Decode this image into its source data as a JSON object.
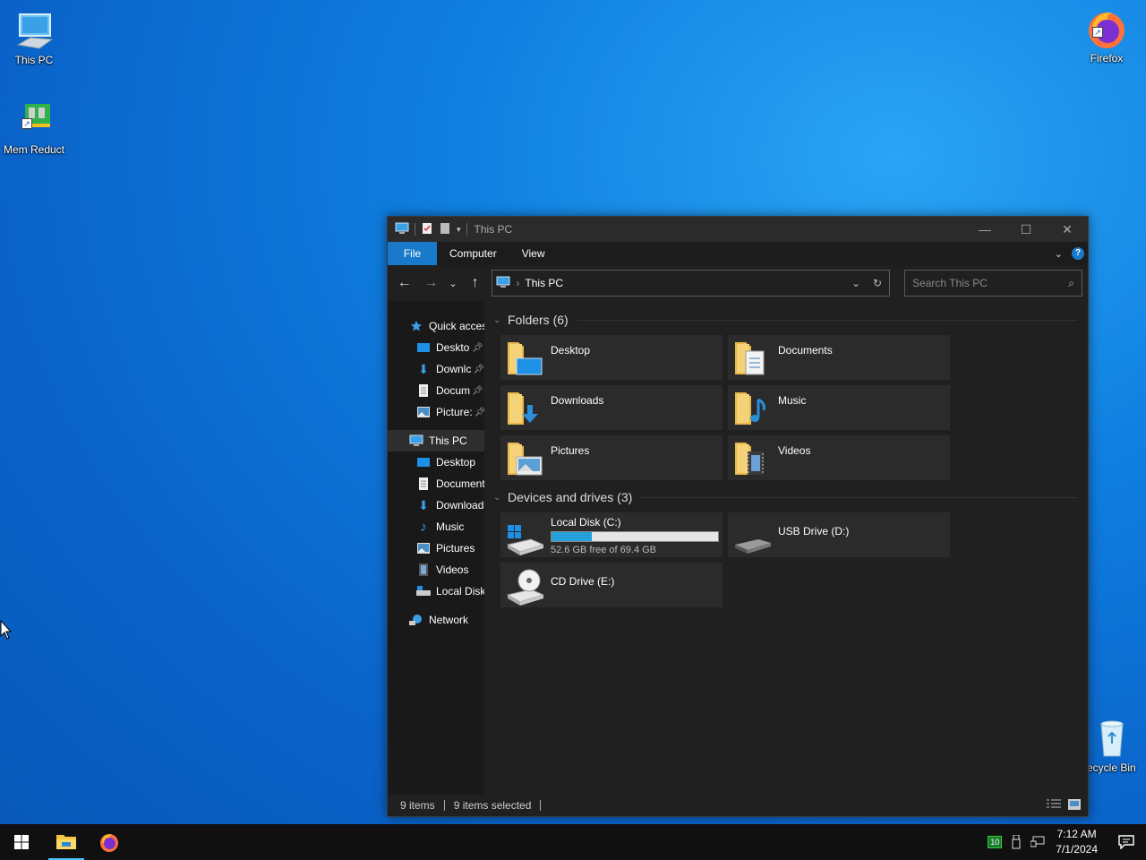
{
  "desktop": {
    "icons": [
      {
        "label": "This PC"
      },
      {
        "label": "Mem Reduct"
      },
      {
        "label": "Firefox"
      },
      {
        "label": "ecycle Bin"
      }
    ]
  },
  "window": {
    "title": "This PC",
    "controls": {
      "minimize": "—",
      "maximize": "☐",
      "close": "✕"
    },
    "ribbon": {
      "tabs": [
        "File",
        "Computer",
        "View"
      ],
      "help": "?"
    },
    "address": {
      "crumb": "This PC"
    },
    "search": {
      "placeholder": "Search This PC"
    },
    "tree": [
      {
        "label": "Quick acces",
        "pin": false
      },
      {
        "label": "Desktop",
        "pin": true
      },
      {
        "label": "Downlc",
        "pin": true
      },
      {
        "label": "Docum",
        "pin": true
      },
      {
        "label": "Picture:",
        "pin": true
      },
      {
        "label": "This PC"
      },
      {
        "label": "Desktop"
      },
      {
        "label": "Document"
      },
      {
        "label": "Download"
      },
      {
        "label": "Music"
      },
      {
        "label": "Pictures"
      },
      {
        "label": "Videos"
      },
      {
        "label": "Local Disk"
      },
      {
        "label": "Network"
      }
    ],
    "groups": {
      "folders": {
        "title": "Folders (6)",
        "items": [
          "Desktop",
          "Documents",
          "Downloads",
          "Music",
          "Pictures",
          "Videos"
        ]
      },
      "drives": {
        "title": "Devices and drives (3)",
        "items": [
          {
            "name": "Local Disk (C:)",
            "free": "52.6 GB free of 69.4 GB",
            "used_fraction": 0.242
          },
          {
            "name": "USB Drive (D:)"
          },
          {
            "name": "CD Drive (E:)"
          }
        ]
      }
    },
    "status": {
      "items": "9 items",
      "selected": "9 items selected"
    }
  },
  "taskbar": {
    "clock": {
      "time": "7:12 AM",
      "date": "7/1/2024"
    },
    "tray": {
      "memreduct": "10"
    }
  },
  "colors": {
    "accent": "#1979ca",
    "drive_fill": "#26a0da",
    "window_bg": "#202020"
  }
}
